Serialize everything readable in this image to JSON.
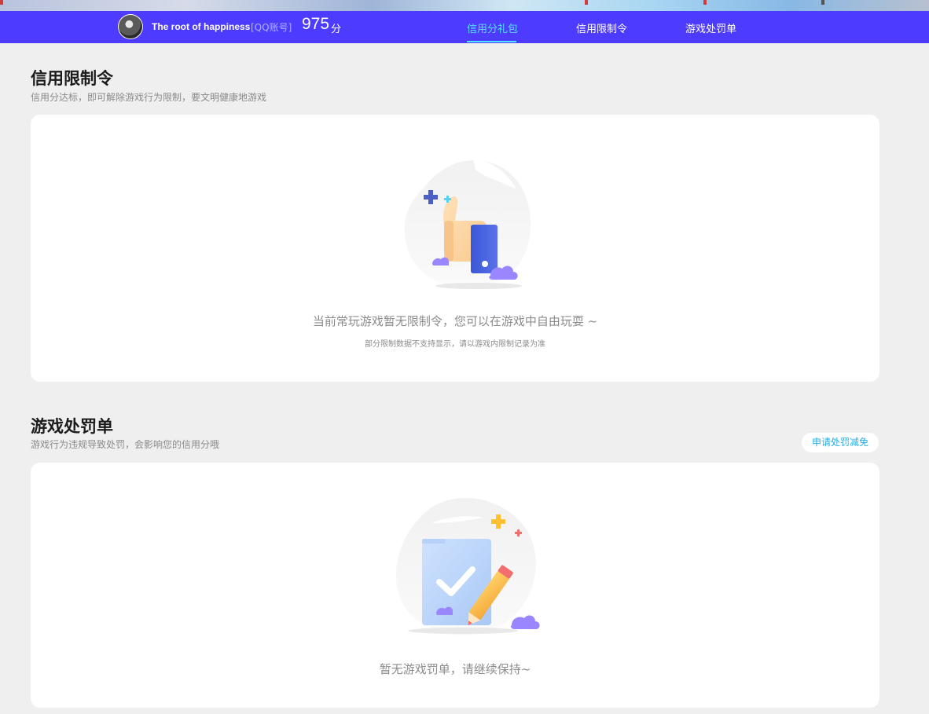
{
  "header": {
    "username": "The root of happiness",
    "account_type": "[QQ账号]",
    "score": "975",
    "score_unit": "分",
    "tabs": [
      {
        "label": "信用分礼包",
        "active": true
      },
      {
        "label": "信用限制令",
        "active": false
      },
      {
        "label": "游戏处罚单",
        "active": false
      }
    ]
  },
  "restriction": {
    "title": "信用限制令",
    "description": "信用分达标，即可解除游戏行为限制，要文明健康地游戏",
    "empty_message": "当前常玩游戏暂无限制令，您可以在游戏中自由玩耍 ~",
    "empty_note": "部分限制数据不支持显示，请以游戏内限制记录为准"
  },
  "penalty": {
    "title": "游戏处罚单",
    "description": "游戏行为违规导致处罚，会影响您的信用分哦",
    "appeal_button": "申请处罚减免",
    "empty_message": "暂无游戏罚单，请继续保持~"
  },
  "colors": {
    "navbar": "#4d3bff",
    "active_tab": "#55e2ff",
    "appeal_text": "#22aee3"
  }
}
